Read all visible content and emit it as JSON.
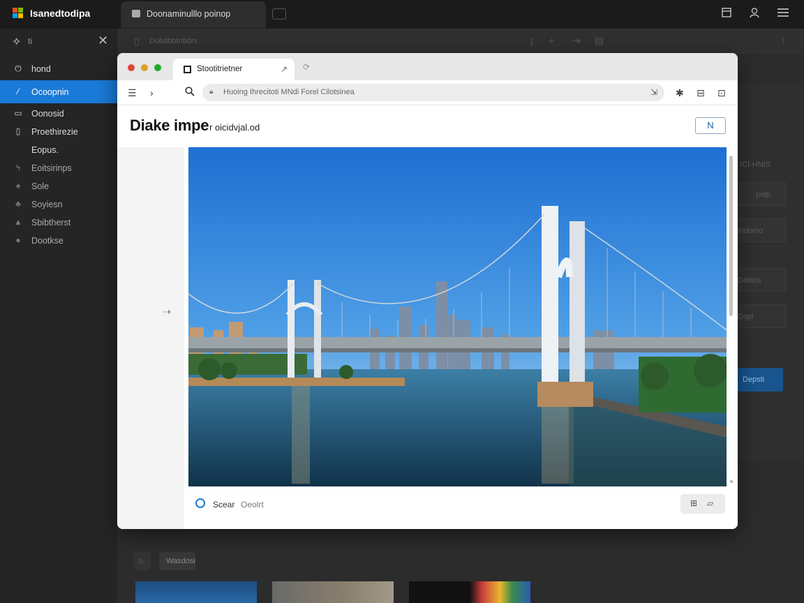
{
  "app": {
    "title": "Isanedtodipa"
  },
  "top_tab": {
    "label": "Doonaminulllo poinop"
  },
  "sidebar": {
    "top_label": "ti",
    "items": [
      {
        "label": "hond",
        "icon": "power-icon"
      },
      {
        "label": "Ocoopnin",
        "icon": "edit-icon",
        "active": true
      },
      {
        "label": "Oonosid",
        "icon": "card-icon"
      },
      {
        "label": "Proethirezie",
        "icon": "square-icon"
      },
      {
        "label": "Eopus.",
        "icon": ""
      },
      {
        "label": "Eoitsirinps",
        "icon": "lightning-icon"
      },
      {
        "label": "Sole",
        "icon": "drop-icon"
      },
      {
        "label": "Soyiesn",
        "icon": "drop-icon"
      },
      {
        "label": "Sbibtherst",
        "icon": "bell-icon"
      },
      {
        "label": "Dootkse",
        "icon": "chat-icon"
      }
    ]
  },
  "background": {
    "toolbar_label": "Dobdbbtnbdrs",
    "panel_labels": [
      "ICI-HNIS",
      "pidp",
      "Indoino",
      "Deltios",
      "Dopl"
    ],
    "blue_button_label": "Depsti",
    "chip_label": "Wasdosi"
  },
  "browser": {
    "tab_label": "Stootitrietner",
    "address": "Huoing Ihrecitoti MNdi Forel Cilotsinea",
    "page_title": "Diake impe",
    "page_subtitle": "r oicidvjal.od",
    "edit_button": "N",
    "search_label": "Scear",
    "search_hint": "Oeolrt",
    "colors": {
      "accent": "#1a7ad8",
      "traffic_red": "#e0443e",
      "traffic_yellow": "#dea123",
      "traffic_green": "#1aab29"
    }
  }
}
